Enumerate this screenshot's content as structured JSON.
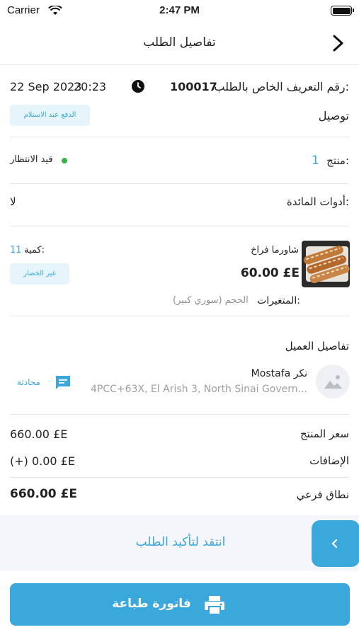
{
  "status_bar": {
    "carrier": "Carrier",
    "time": "2:47 PM"
  },
  "header": {
    "title": "تفاصيل الطلب"
  },
  "order": {
    "id_label": "رقم التعريف الخاص بالطلب:",
    "id_value": "100017",
    "date": "22 Sep 2023",
    "time": "20:23",
    "delivery_label": "توصيل",
    "payment_badge": "الدفع عند الاستلام",
    "product_count_label": "منتج:",
    "product_count": "1",
    "status": "قيد الانتظار",
    "cutlery_label": "أدوات المائدة:",
    "cutlery_value": "لا"
  },
  "item": {
    "name": "شاورما فراخ",
    "price": "60.00 £E",
    "qty_label": "كمية:",
    "qty": "11",
    "paid_badge": "غير الخضار",
    "variants_label": "المتغيرات:",
    "variants_value": "الحجم (سوري كبير)"
  },
  "customer": {
    "section_title": "تفاصيل العميل",
    "name": "Mostafa نكر",
    "address": "4PCC+63X, El Arish 3, North Sinai Govern...",
    "chat_label": "محادثة"
  },
  "summary": {
    "item_price_label": "سعر المنتج",
    "item_price": "660.00 £E",
    "addons_label": "الإضافات",
    "addons": "(+) 0.00 £E",
    "subtotal_label": "نطاق فرعي",
    "subtotal": "660.00 £E"
  },
  "actions": {
    "confirm_label": "انتقد لتأكيد الطلب",
    "print_label": "فاتورة طباعة"
  },
  "colors": {
    "accent": "#3aa8db",
    "status_dot": "#36b34a"
  },
  "icons": {
    "back": "chevron-right-icon",
    "clock": "clock-icon",
    "chat": "chat-icon",
    "print": "printer-icon",
    "avatar": "image-placeholder-icon",
    "confirm": "chevron-left-icon"
  }
}
